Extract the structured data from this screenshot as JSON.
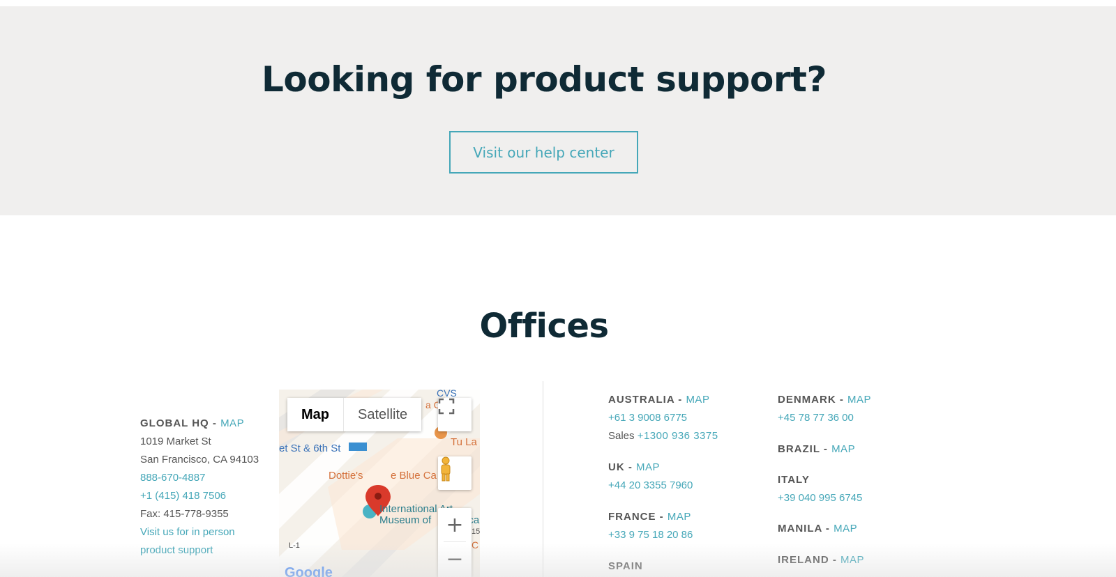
{
  "support": {
    "title": "Looking for product support?",
    "button_label": "Visit our help center"
  },
  "offices": {
    "title": "Offices",
    "map_link_label": "MAP",
    "hq": {
      "name": "GLOBAL HQ - ",
      "address_line1": "1019 Market St",
      "address_line2": "San Francisco, CA 94103",
      "phone1": "888-670-4887",
      "phone2": "+1 (415) 418 7506",
      "fax": "Fax: 415-778-9355",
      "visit_line1": "Visit us for in person",
      "visit_line2": "product support"
    },
    "map": {
      "type_map": "Map",
      "type_satellite": "Satellite",
      "zoom_in": "+",
      "zoom_out": "−",
      "labels": {
        "cvs": "CVS",
        "street": "et St & 6th St",
        "restaurant_partial": "a C",
        "tu_la": "Tu La",
        "dotties": "Dottie's",
        "dotties_rest": "e Blue Ca",
        "museum_line1": "International Art",
        "museum_line2": "Museum of",
        "museum_partial": "ica",
        "number_15": "15",
        "c_partial": "C",
        "level": "L-1",
        "google": "Google"
      },
      "colors": {
        "pin": "#d93a2b",
        "poi_orange": "#e8954a",
        "transit_blue": "#3a8fd1",
        "museum_teal": "#4ab3c4"
      }
    },
    "australia": {
      "name": "AUSTRALIA - ",
      "phone": "+61 3 9008 6775",
      "sales_label": "Sales ",
      "sales_phone": "+1300 936 3375"
    },
    "uk": {
      "name": "UK - ",
      "phone": "+44 20 3355 7960"
    },
    "france": {
      "name": "FRANCE - ",
      "phone": "+33 9 75 18 20 86"
    },
    "spain": {
      "name": "SPAIN"
    },
    "denmark": {
      "name": "DENMARK - ",
      "phone": "+45 78 77 36 00"
    },
    "brazil": {
      "name": "BRAZIL - "
    },
    "italy": {
      "name": "ITALY",
      "phone": "+39 040 995 6745"
    },
    "manila": {
      "name": "MANILA - "
    },
    "ireland": {
      "name": "IRELAND - "
    }
  },
  "colors": {
    "accent": "#45a7b8",
    "heading": "#0f2a35",
    "support_bg": "#f0efee",
    "body_text": "#555555"
  }
}
